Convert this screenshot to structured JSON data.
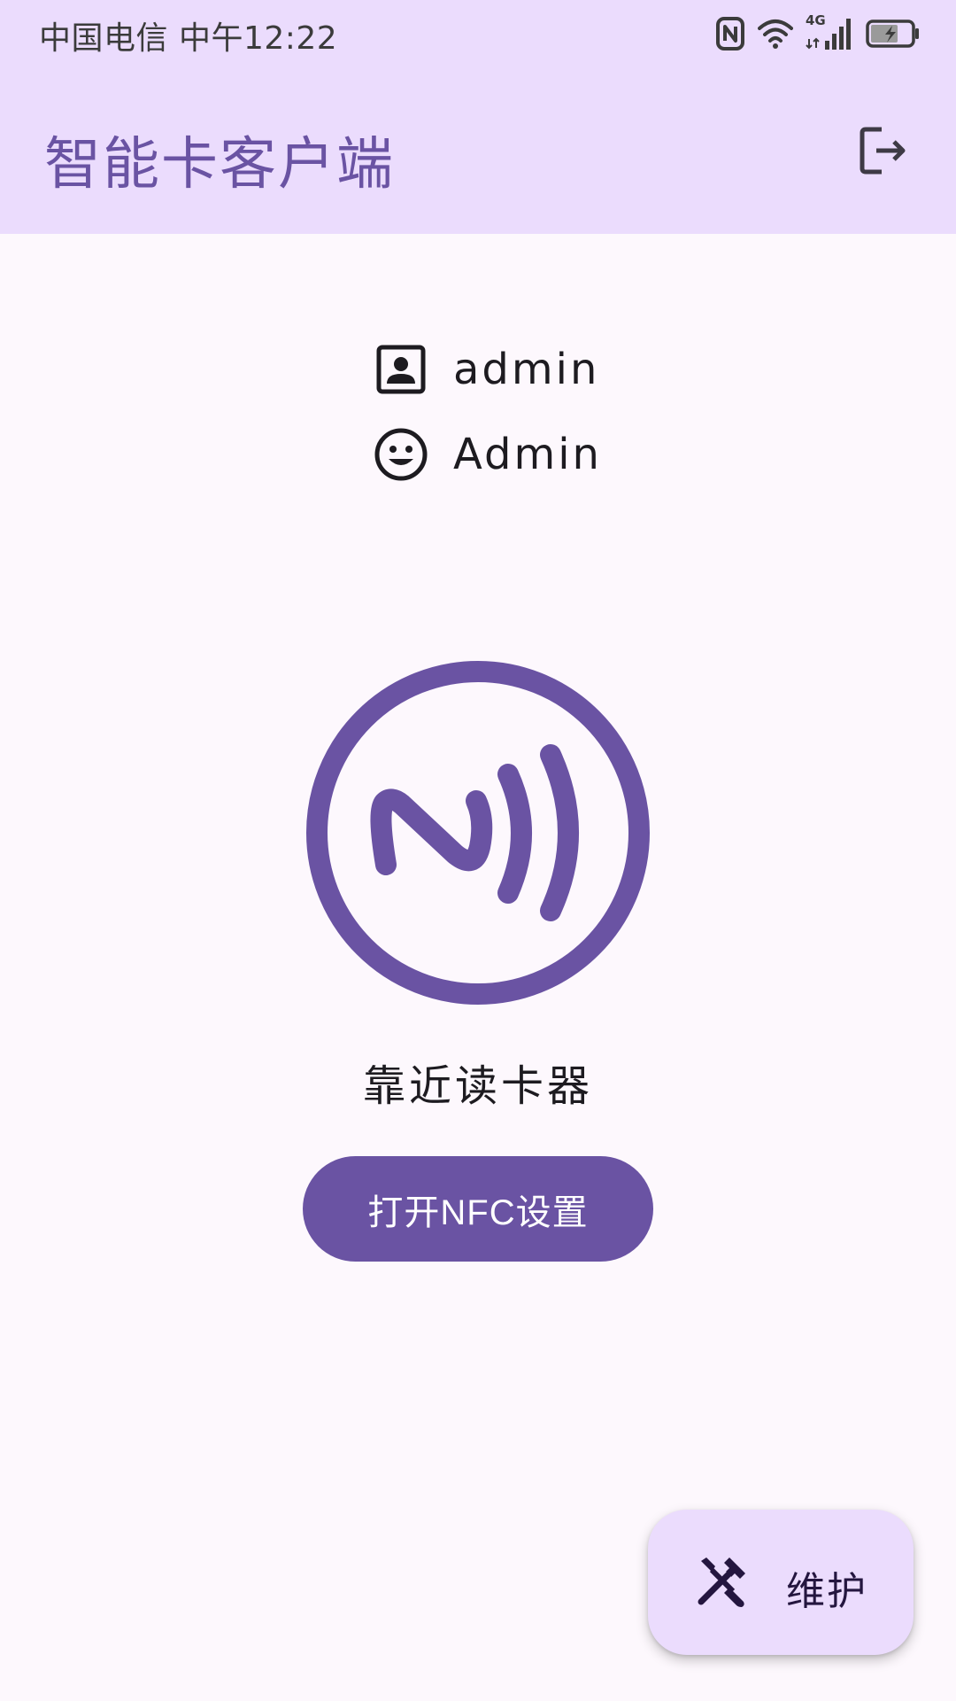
{
  "status_bar": {
    "carrier_time": "中国电信 中午12:22",
    "network_label": "4G"
  },
  "app_bar": {
    "title": "智能卡客户端"
  },
  "user": {
    "username": "admin",
    "role": "Admin"
  },
  "main": {
    "hint": "靠近读卡器",
    "open_nfc_button": "打开NFC设置"
  },
  "fab": {
    "label": "维护"
  },
  "colors": {
    "primary": "#6a53a3",
    "app_bar_bg": "#ebdcfd",
    "background": "#fdf8fd"
  },
  "icons": {
    "logout": "logout-icon",
    "username": "account-box-icon",
    "role": "smiley-face-icon",
    "nfc": "nfc-icon",
    "fab": "tools-icon"
  }
}
